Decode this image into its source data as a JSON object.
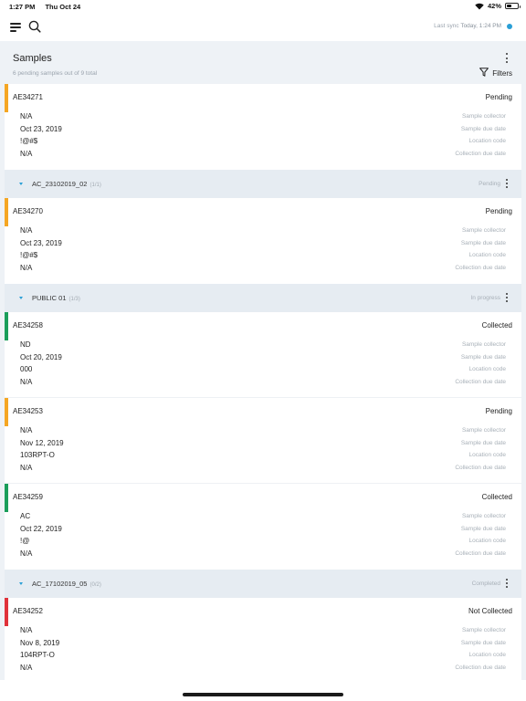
{
  "status_bar": {
    "time": "1:27 PM",
    "date": "Thu Oct 24",
    "battery": "42%",
    "battery_level": 0.42
  },
  "top_bar": {
    "sync_label": "Last sync",
    "sync_value": "Today, 1:24 PM",
    "sync_dot_color": "#2a9fd6"
  },
  "header": {
    "title": "Samples",
    "subtitle": "6 pending samples out of 9 total",
    "filters_label": "Filters"
  },
  "field_labels": {
    "collector": "Sample collector",
    "due": "Sample due date",
    "location": "Location code",
    "collection_due": "Collection due date"
  },
  "status_colors": {
    "Pending": "#f5a623",
    "Collected": "#1a9e5a",
    "Not Collected": "#e0323a"
  },
  "items": [
    {
      "type": "card",
      "id": "AE34271",
      "status": "Pending",
      "collector": "N/A",
      "due": "Oct 23, 2019",
      "location": "!@#$",
      "collection_due": "N/A"
    },
    {
      "type": "group",
      "name": "AC_23102019_02",
      "count": "(1/1)",
      "state": "Pending"
    },
    {
      "type": "card",
      "id": "AE34270",
      "status": "Pending",
      "collector": "N/A",
      "due": "Oct 23, 2019",
      "location": "!@#$",
      "collection_due": "N/A"
    },
    {
      "type": "group",
      "name": "PUBLIC 01",
      "count": "(1/3)",
      "state": "In progress"
    },
    {
      "type": "card",
      "id": "AE34258",
      "status": "Collected",
      "collector": "ND",
      "due": "Oct 20, 2019",
      "location": "000",
      "collection_due": "N/A"
    },
    {
      "type": "card",
      "id": "AE34253",
      "status": "Pending",
      "collector": "N/A",
      "due": "Nov 12, 2019",
      "location": "103RPT-O",
      "collection_due": "N/A"
    },
    {
      "type": "card",
      "id": "AE34259",
      "status": "Collected",
      "collector": "AC",
      "due": "Oct 22, 2019",
      "location": "!@",
      "collection_due": "N/A"
    },
    {
      "type": "group",
      "name": "AC_17102019_05",
      "count": "(0/2)",
      "state": "Completed"
    },
    {
      "type": "card",
      "id": "AE34252",
      "status": "Not Collected",
      "collector": "N/A",
      "due": "Nov 8, 2019",
      "location": "104RPT-O",
      "collection_due": "N/A"
    }
  ]
}
